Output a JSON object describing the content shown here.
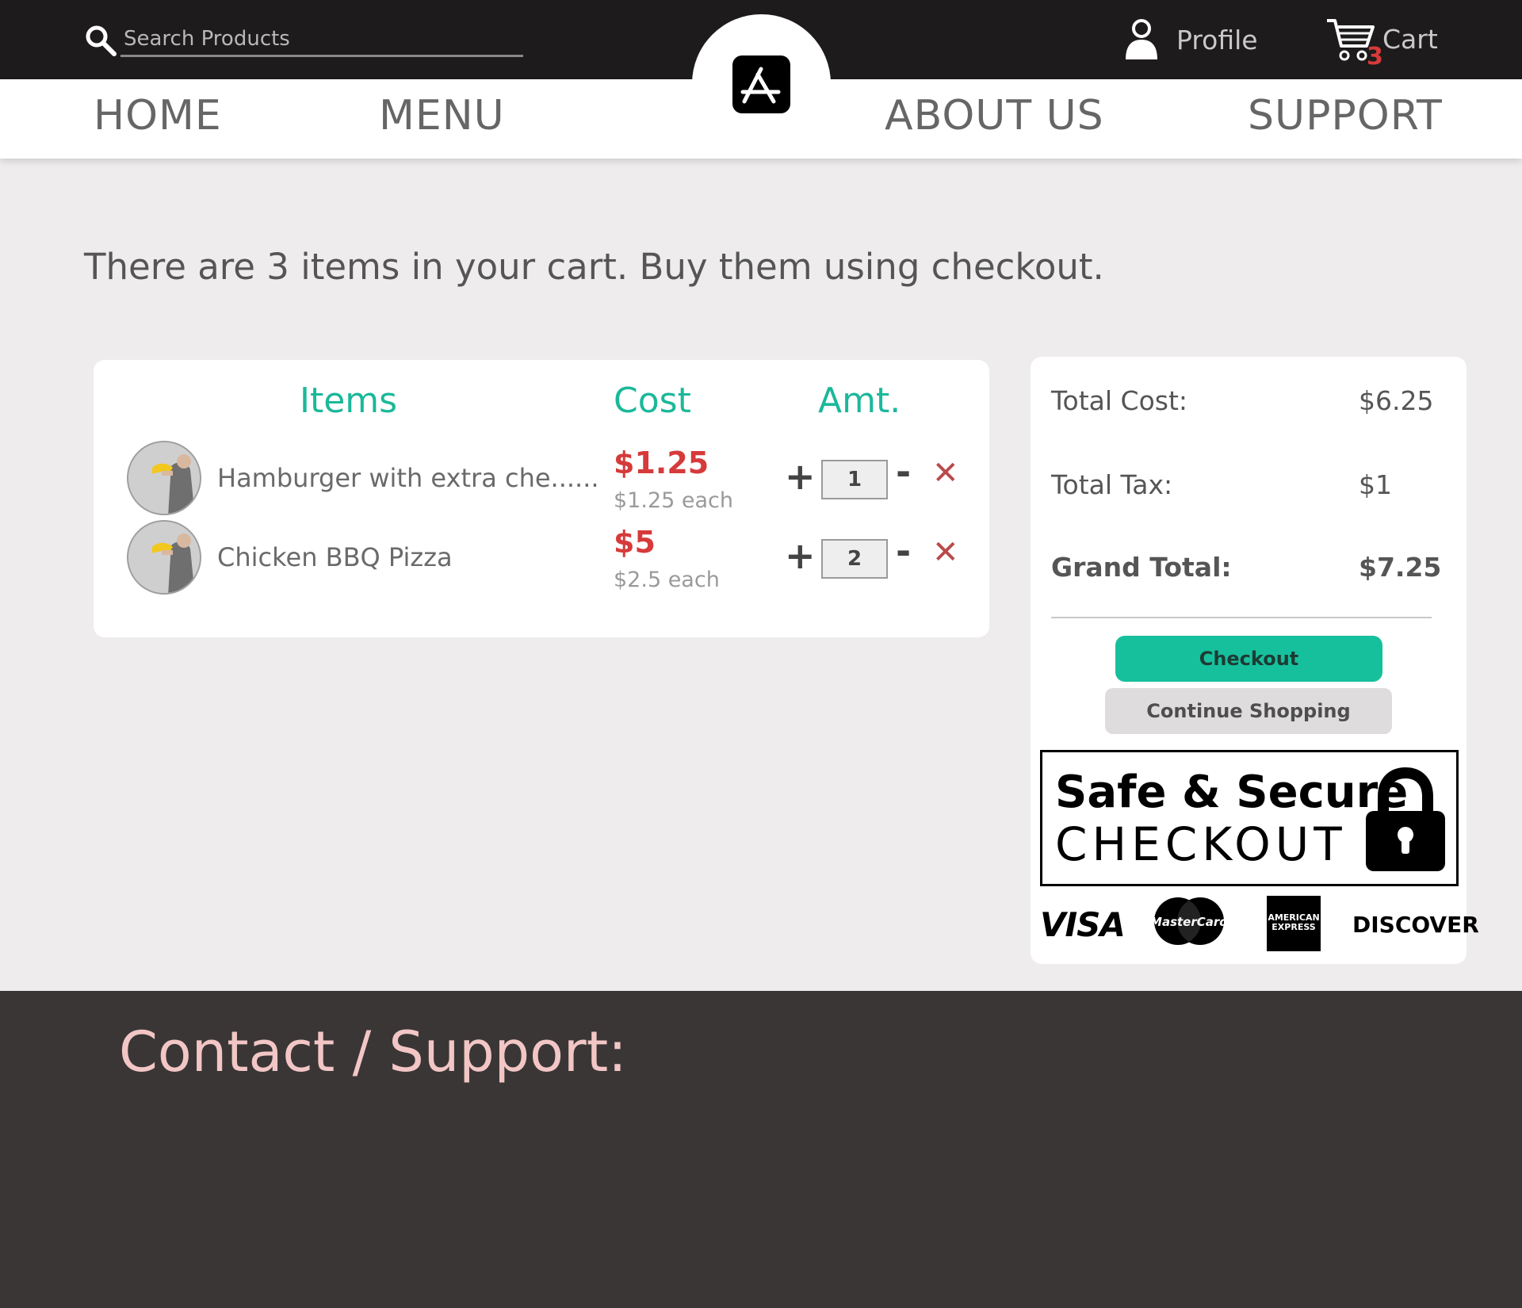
{
  "header": {
    "search": {
      "placeholder": "Search Products",
      "value": ""
    },
    "profile_label": "Profile",
    "cart_label": "Cart",
    "cart_count": "3"
  },
  "nav": {
    "home": "HOME",
    "menu": "MENU",
    "about": "ABOUT US",
    "support": "SUPPORT"
  },
  "intro_text": "There are 3 items in your cart. Buy them using checkout.",
  "cart": {
    "columns": {
      "items": "Items",
      "cost": "Cost",
      "amt": "Amt."
    },
    "rows": [
      {
        "name": "Hamburger with extra che......",
        "price": "$1.25",
        "each": "$1.25 each",
        "qty": "1"
      },
      {
        "name": "Chicken BBQ Pizza",
        "price": "$5",
        "each": "$2.5 each",
        "qty": "2"
      }
    ],
    "plus_symbol": "+",
    "minus_symbol": "-",
    "remove_symbol": "✕"
  },
  "summary": {
    "total_cost_label": "Total Cost:",
    "total_cost_value": "$6.25",
    "total_tax_label": "Total Tax:",
    "total_tax_value": "$1",
    "grand_total_label": "Grand Total:",
    "grand_total_value": "$7.25",
    "checkout_label": "Checkout",
    "continue_label": "Continue Shopping"
  },
  "secure_badge": {
    "line1": "Safe & Secure",
    "line2": "CHECKOUT",
    "logos": {
      "visa": "VISA",
      "mastercard": "MasterCard",
      "amex": "AMERICAN EXPRESS",
      "discover": "DISCOVER"
    }
  },
  "footer": {
    "title": "Contact / Support:"
  },
  "colors": {
    "accent": "#1bb89a",
    "price_red": "#d63a3a",
    "topbar": "#1d1b1c",
    "footer": "#3a3636",
    "footer_text": "#f3c6c6"
  }
}
